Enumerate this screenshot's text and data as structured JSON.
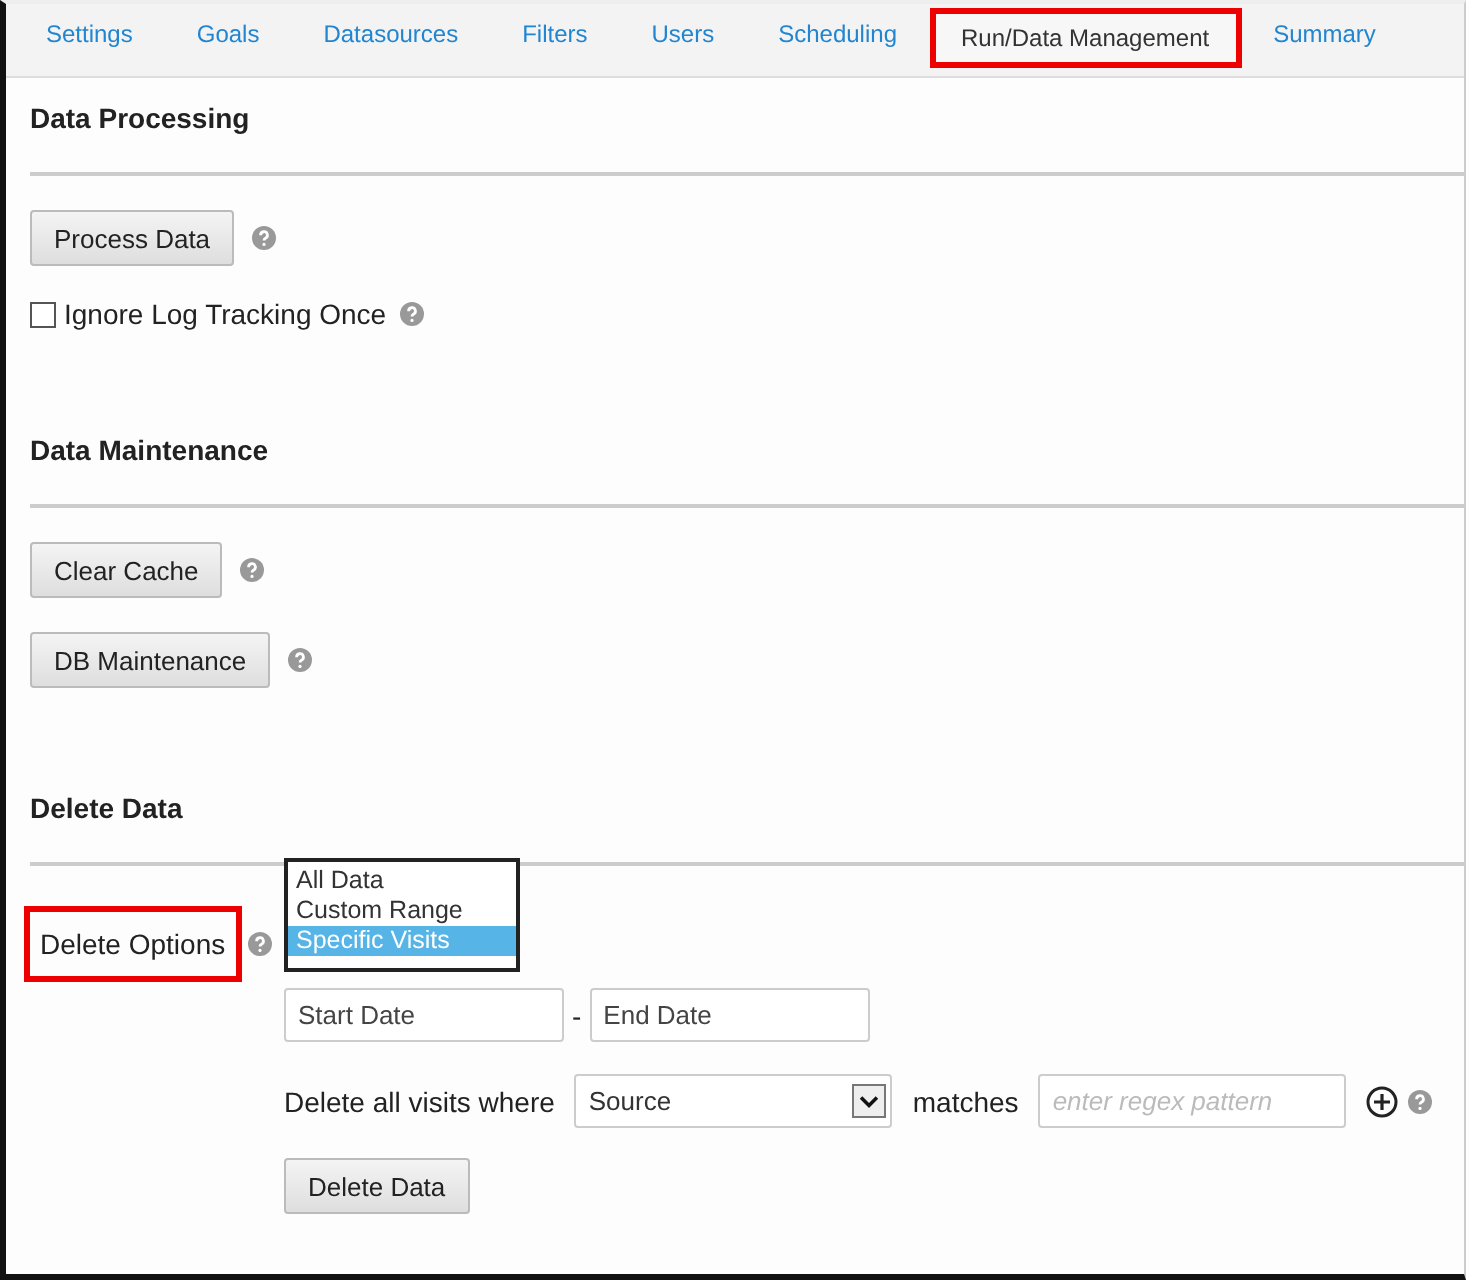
{
  "tabs": [
    {
      "label": "Settings",
      "selected": false,
      "highlighted": false
    },
    {
      "label": "Goals",
      "selected": false,
      "highlighted": false
    },
    {
      "label": "Datasources",
      "selected": false,
      "highlighted": false
    },
    {
      "label": "Filters",
      "selected": false,
      "highlighted": false
    },
    {
      "label": "Users",
      "selected": false,
      "highlighted": false
    },
    {
      "label": "Scheduling",
      "selected": false,
      "highlighted": false
    },
    {
      "label": "Run/Data Management",
      "selected": true,
      "highlighted": true
    },
    {
      "label": "Summary",
      "selected": false,
      "highlighted": false
    }
  ],
  "data_processing": {
    "heading": "Data Processing",
    "process_button": "Process Data",
    "ignore_log": {
      "label": "Ignore Log Tracking Once",
      "checked": false
    }
  },
  "data_maintenance": {
    "heading": "Data Maintenance",
    "buttons": [
      "Clear Cache",
      "DB Maintenance"
    ]
  },
  "delete_data": {
    "heading": "Delete Data",
    "delete_options": {
      "label": "Delete Options",
      "highlighted": true,
      "options": [
        {
          "label": "All Data",
          "selected": false
        },
        {
          "label": "Custom Range",
          "selected": false
        },
        {
          "label": "Specific Visits",
          "selected": true
        }
      ]
    },
    "start_date": {
      "placeholder": "Start Date"
    },
    "separator": "-",
    "end_date": {
      "placeholder": "End Date"
    },
    "where_label": "Delete all visits where",
    "field_select": {
      "value": "Source"
    },
    "matches_label": "matches",
    "pattern": {
      "placeholder": "enter regex pattern"
    },
    "delete_button": "Delete Data"
  }
}
